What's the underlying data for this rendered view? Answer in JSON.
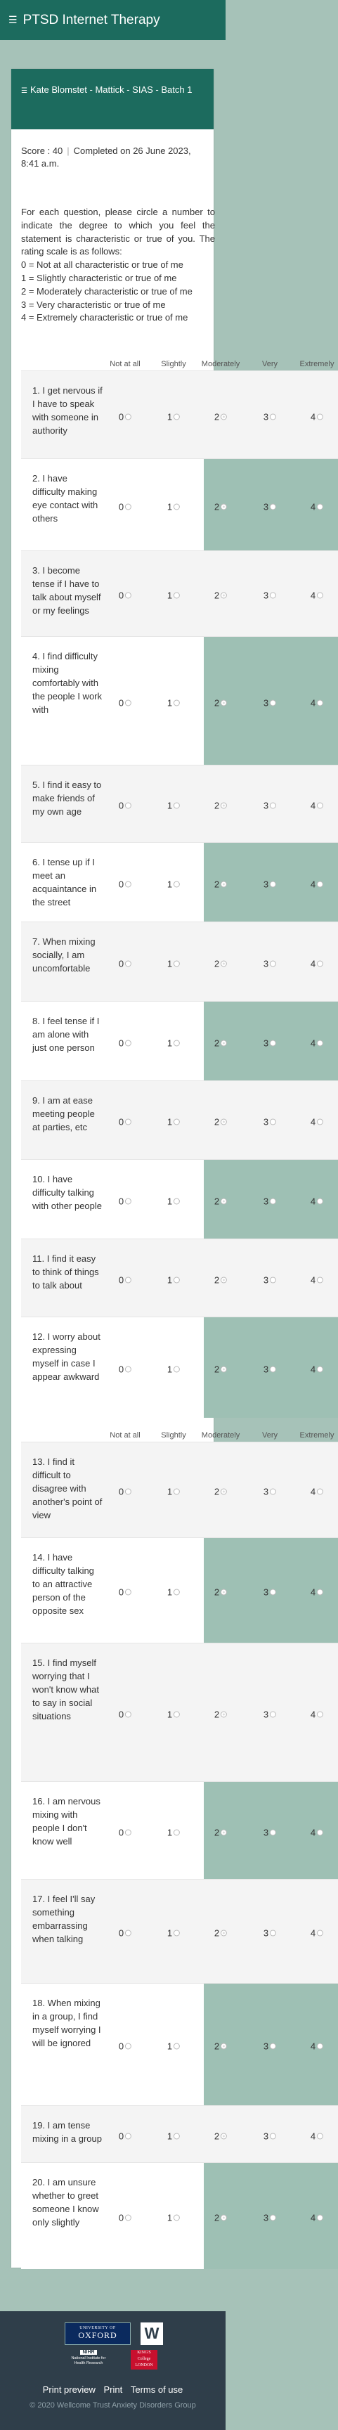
{
  "app": {
    "title": "PTSD Internet Therapy"
  },
  "card": {
    "header": "Kate Blomstet - Mattick - SIAS - Batch 1",
    "score": "Score : 40",
    "completed": "Completed on 26 June 2023, 8:41 a.m.",
    "intro": "For each question, please circle a number to indicate the degree to which you feel the statement is characteristic or true of you. The rating scale is as follows:",
    "scale": [
      "0 = Not at all characteristic or true of me",
      "1 = Slightly characteristic or true of me",
      "2 = Moderately characteristic or true of me",
      "3 = Very characteristic or true of me",
      "4 = Extremely characteristic or true of me"
    ]
  },
  "columns": [
    "Not at all",
    "Slightly",
    "Moderately",
    "Very",
    "Extremely"
  ],
  "questions": [
    {
      "text": "1. I get nervous if I have to speak with someone in authority",
      "selected": 2
    },
    {
      "text": "2. I have difficulty making eye contact with others",
      "selected": 2
    },
    {
      "text": "3. I become tense if I have to talk about myself or my feelings",
      "selected": 2
    },
    {
      "text": "4. I find difficulty mixing comfortably with the people I work with",
      "selected": 2
    },
    {
      "text": "5. I find it easy to make friends of my own age",
      "selected": 2
    },
    {
      "text": "6. I tense up if I meet an acquaintance in the street",
      "selected": 2
    },
    {
      "text": "7. When mixing socially, I am uncomfortable",
      "selected": 2
    },
    {
      "text": "8. I feel tense if I am alone with just one person",
      "selected": 2
    },
    {
      "text": "9. I am at ease meeting people at parties, etc",
      "selected": 2
    },
    {
      "text": "10. I have difficulty talking with other people",
      "selected": 2
    },
    {
      "text": "11. I find it easy to think of things to talk about",
      "selected": 2
    },
    {
      "text": "12. I worry about expressing myself in case I appear awkward",
      "selected": 2
    },
    {
      "text": "13. I find it difficult to disagree with another's point of view",
      "selected": 2
    },
    {
      "text": "14. I have difficulty talking to an attractive person of the opposite sex",
      "selected": 2
    },
    {
      "text": "15. I find myself worrying that I won't know what to say in social situations",
      "selected": 2
    },
    {
      "text": "16. I am nervous mixing with people I don't know well",
      "selected": 2
    },
    {
      "text": "17. I feel I'll say something embarrassing when talking",
      "selected": 2
    },
    {
      "text": "18. When mixing in a group, I find myself worrying I will be ignored",
      "selected": 2
    },
    {
      "text": "19. I am tense mixing in a group",
      "selected": 2
    },
    {
      "text": "20. I am unsure whether to greet someone I know only slightly",
      "selected": 2
    }
  ],
  "footer": {
    "oxford_small": "UNIVERSITY OF",
    "oxford": "OXFORD",
    "wellcome": "W",
    "nihr_badge": "NIHR",
    "nihr_text": "National Institute for Health Research",
    "kcl": "KING'S College LONDON",
    "links": [
      "Print preview",
      "Print",
      "Terms of use"
    ],
    "copyright": "© 2020 Wellcome Trust Anxiety Disorders Group"
  }
}
